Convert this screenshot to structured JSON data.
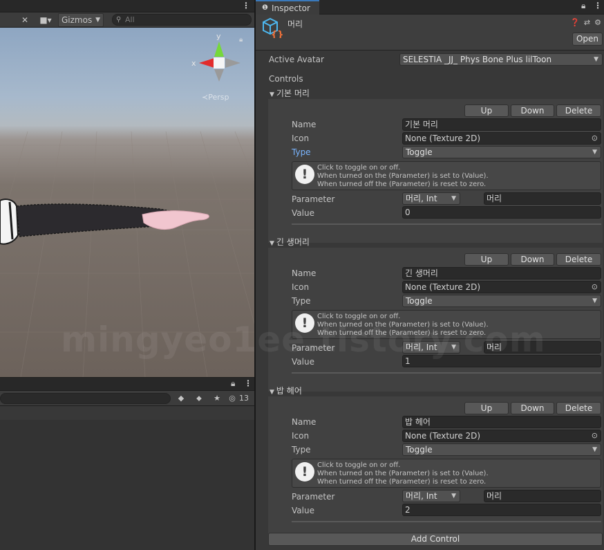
{
  "scene": {
    "gizmos_label": "Gizmos",
    "search_placeholder": "All",
    "axis_y": "y",
    "axis_x": "x",
    "persp_label": "Persp",
    "hidden_count": "13"
  },
  "inspector": {
    "tab_label": "Inspector",
    "object_name": "머리",
    "open_label": "Open",
    "active_avatar_label": "Active Avatar",
    "active_avatar_value": "SELESTIA _JJ_ Phys Bone Plus lilToon",
    "controls_label": "Controls",
    "add_control_label": "Add Control",
    "up_label": "Up",
    "down_label": "Down",
    "delete_label": "Delete",
    "name_label": "Name",
    "icon_label": "Icon",
    "type_label": "Type",
    "parameter_label": "Parameter",
    "value_label": "Value",
    "controls": [
      {
        "title": "기본 머리",
        "name": "기본 머리",
        "icon": "None (Texture 2D)",
        "type": "Toggle",
        "help": [
          "Click to toggle on or off.",
          "When turned on the (Parameter) is set to (Value).",
          "When turned off the (Parameter) is reset to zero."
        ],
        "parameter": "머리, Int",
        "parameter_name": "머리",
        "value": "0"
      },
      {
        "title": "긴 생머리",
        "name": "긴 생머리",
        "icon": "None (Texture 2D)",
        "type": "Toggle",
        "help": [
          "Click to toggle on or off.",
          "When turned on the (Parameter) is set to (Value).",
          "When turned off the (Parameter) is reset to zero."
        ],
        "parameter": "머리, Int",
        "parameter_name": "머리",
        "value": "1"
      },
      {
        "title": "밥 헤어",
        "name": "밥 헤어",
        "icon": "None (Texture 2D)",
        "type": "Toggle",
        "help": [
          "Click to toggle on or off.",
          "When turned on the (Parameter) is set to (Value).",
          "When turned off the (Parameter) is reset to zero."
        ],
        "parameter": "머리, Int",
        "parameter_name": "머리",
        "value": "2"
      }
    ]
  },
  "watermark": "mingyeo1ee.tistory.com"
}
